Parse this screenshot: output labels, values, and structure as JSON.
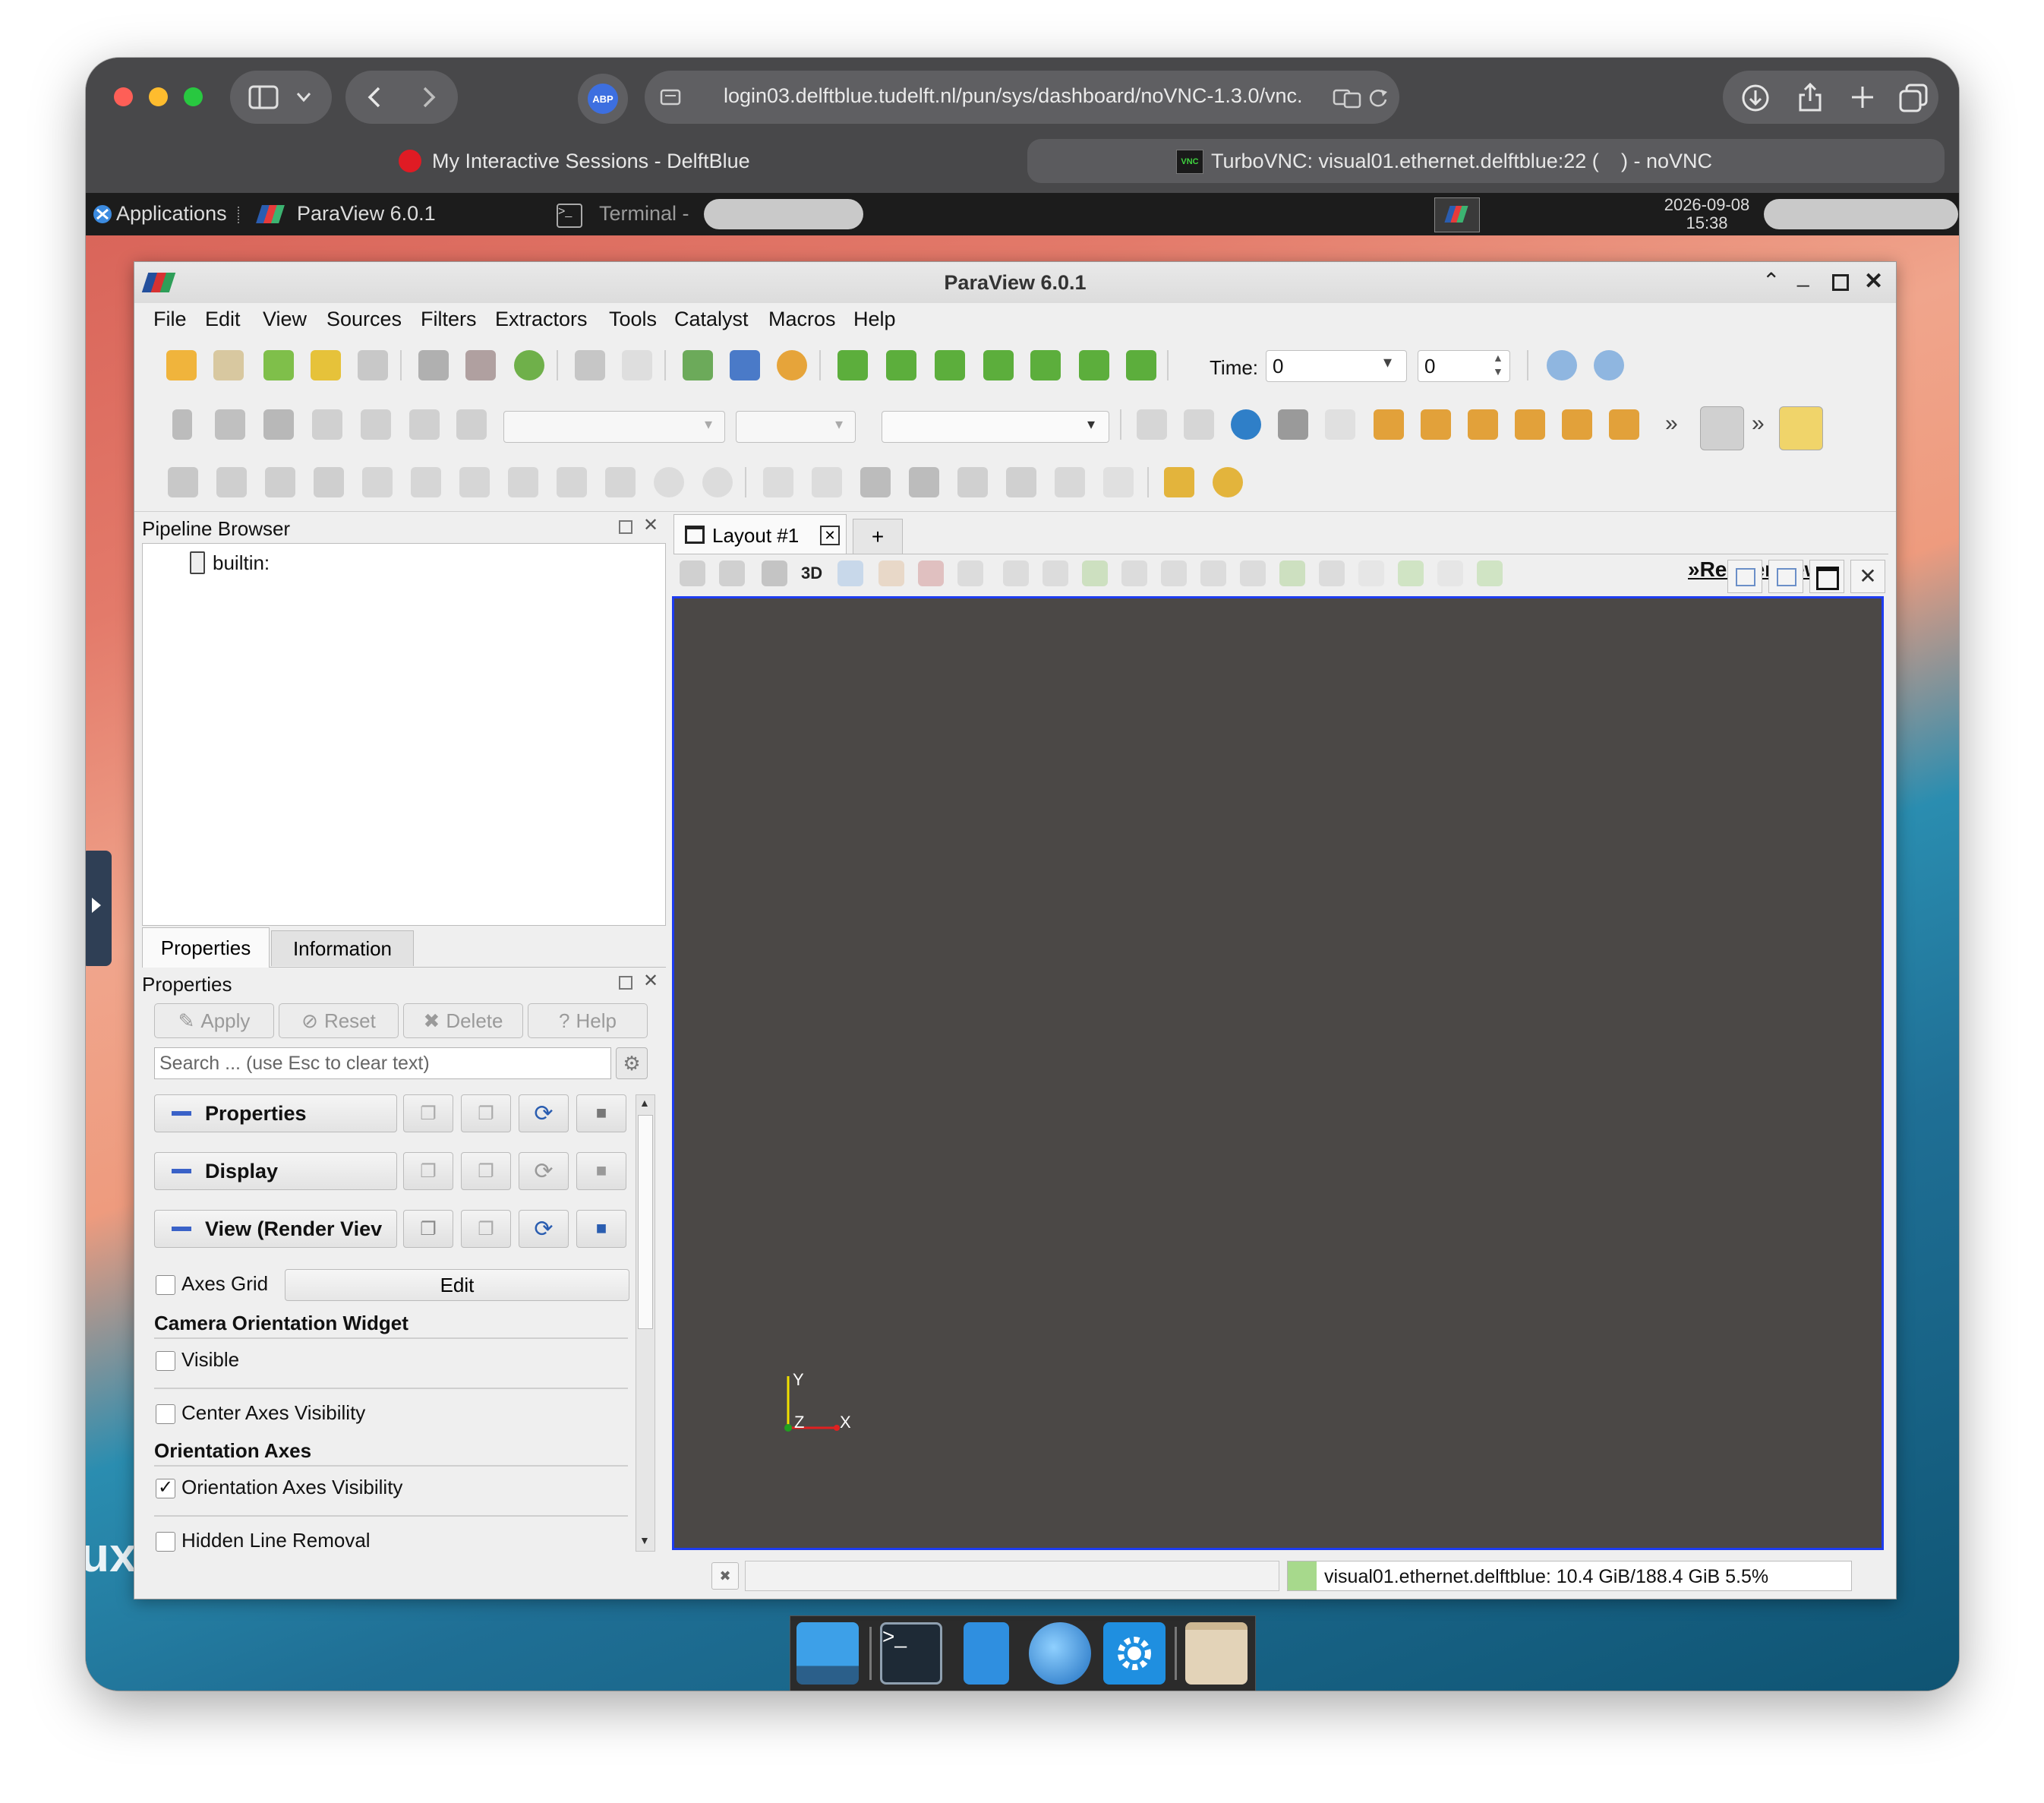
{
  "browser": {
    "url": "login03.delftblue.tudelft.nl/pun/sys/dashboard/noVNC-1.3.0/vnc.",
    "tabs": [
      {
        "label": "My Interactive Sessions - DelftBlue"
      },
      {
        "label": "TurboVNC: visual01.ethernet.delftblue:22 (",
        "suffix": ") - noVNC"
      }
    ]
  },
  "xfce_panel": {
    "applications": "Applications",
    "tasks": [
      "ParaView 6.0.1",
      "Terminal -"
    ],
    "date": "2026-09-08",
    "time": "15:38"
  },
  "paraview": {
    "title": "ParaView 6.0.1",
    "menu": [
      "File",
      "Edit",
      "View",
      "Sources",
      "Filters",
      "Extractors",
      "Tools",
      "Catalyst",
      "Macros",
      "Help"
    ],
    "time_label": "Time:",
    "time_value": "0",
    "time_step": "0",
    "pipeline": {
      "title": "Pipeline Browser",
      "items": [
        "builtin:"
      ]
    },
    "tabs": [
      "Properties",
      "Information"
    ],
    "properties": {
      "title": "Properties",
      "buttons": {
        "apply": "Apply",
        "reset": "Reset",
        "delete": "Delete",
        "help": "Help"
      },
      "search_placeholder": "Search ... (use Esc to clear text)",
      "sections": [
        "Properties",
        "Display",
        "View (Render Viev"
      ],
      "axes_grid": "Axes Grid",
      "edit": "Edit",
      "camera_group": "Camera Orientation Widget",
      "visible": "Visible",
      "center_axes": "Center Axes Visibility",
      "orientation_group": "Orientation Axes",
      "orientation_visibility": "Orientation Axes Visibility",
      "hidden_line": "Hidden Line Removal"
    },
    "layout": {
      "tab": "Layout #1",
      "add": "+",
      "view_label_3d": "3D",
      "render_view": "RenderView1",
      "axes": {
        "y": "Y",
        "z": "Z",
        "x": "X"
      }
    },
    "status": {
      "memory": "visual01.ethernet.delftblue: 10.4 GiB/188.4 GiB 5.5%"
    }
  },
  "colors": {
    "render_bg": "#4b4846",
    "accent_blue": "#1d3cf0",
    "panel_bg": "#efefef"
  }
}
